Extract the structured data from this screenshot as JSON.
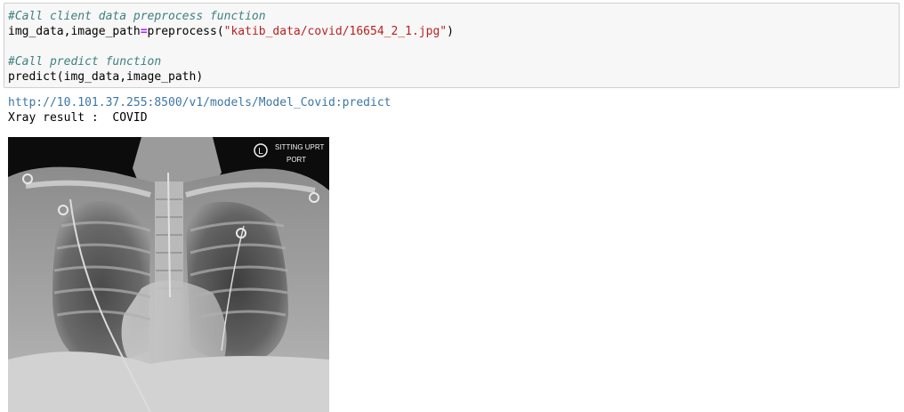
{
  "code_cell": {
    "line1_comment": "#Call client data preprocess function",
    "line2_lhs": "img_data,image_path",
    "line2_op": "=",
    "line2_func": "preprocess(",
    "line2_str": "\"katib_data/covid/16654_2_1.jpg\"",
    "line2_close": ")",
    "line3_comment": "#Call predict function",
    "line4": "predict(img_data,image_path)"
  },
  "output": {
    "url": "http://10.101.37.255:8500/v1/models/Model_Covid:predict",
    "result": "Xray result :  COVID"
  },
  "xray_image": {
    "marker": "L",
    "label_line1": "SITTING UPRT",
    "label_line2": "PORT"
  }
}
